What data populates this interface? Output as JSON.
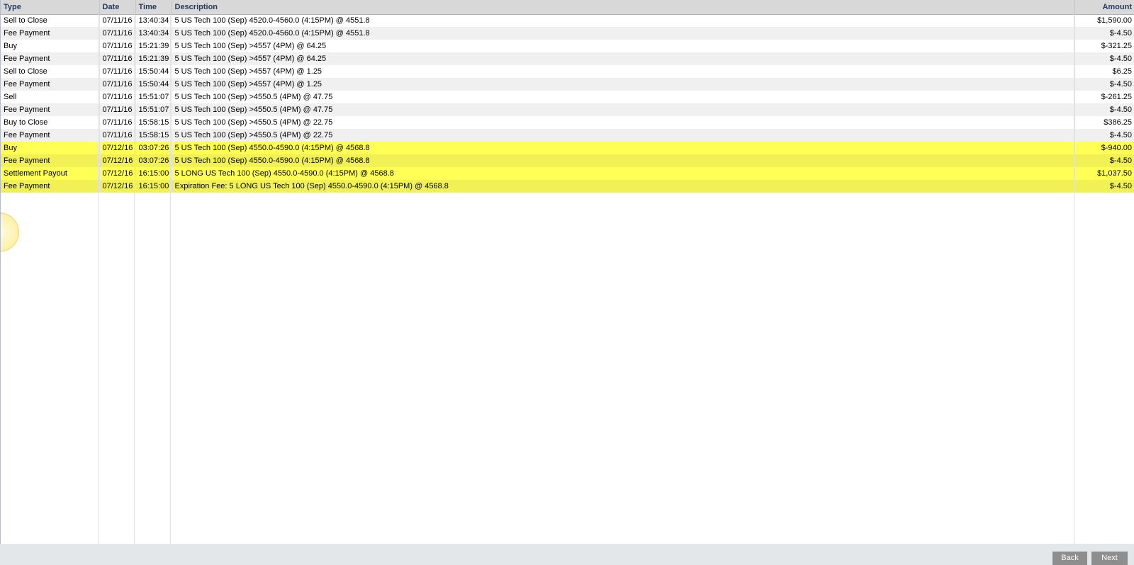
{
  "table": {
    "columns": {
      "type": "Type",
      "date": "Date",
      "time": "Time",
      "description": "Description",
      "amount": "Amount"
    },
    "rows": [
      {
        "type": "Sell to Close",
        "date": "07/11/16",
        "time": "13:40:34",
        "description": "5 US Tech 100 (Sep) 4520.0-4560.0 (4:15PM) @ 4551.8",
        "amount": "$1,590.00",
        "highlighted": false
      },
      {
        "type": "Fee Payment",
        "date": "07/11/16",
        "time": "13:40:34",
        "description": "5 US Tech 100 (Sep) 4520.0-4560.0 (4:15PM) @ 4551.8",
        "amount": "$-4.50",
        "highlighted": false
      },
      {
        "type": "Buy",
        "date": "07/11/16",
        "time": "15:21:39",
        "description": "5 US Tech 100 (Sep) >4557 (4PM) @ 64.25",
        "amount": "$-321.25",
        "highlighted": false
      },
      {
        "type": "Fee Payment",
        "date": "07/11/16",
        "time": "15:21:39",
        "description": "5 US Tech 100 (Sep) >4557 (4PM) @ 64.25",
        "amount": "$-4.50",
        "highlighted": false
      },
      {
        "type": "Sell to Close",
        "date": "07/11/16",
        "time": "15:50:44",
        "description": "5 US Tech 100 (Sep) >4557 (4PM) @ 1.25",
        "amount": "$6.25",
        "highlighted": false
      },
      {
        "type": "Fee Payment",
        "date": "07/11/16",
        "time": "15:50:44",
        "description": "5 US Tech 100 (Sep) >4557 (4PM) @ 1.25",
        "amount": "$-4.50",
        "highlighted": false
      },
      {
        "type": "Sell",
        "date": "07/11/16",
        "time": "15:51:07",
        "description": "5 US Tech 100 (Sep) >4550.5 (4PM) @ 47.75",
        "amount": "$-261.25",
        "highlighted": false
      },
      {
        "type": "Fee Payment",
        "date": "07/11/16",
        "time": "15:51:07",
        "description": "5 US Tech 100 (Sep) >4550.5 (4PM) @ 47.75",
        "amount": "$-4.50",
        "highlighted": false
      },
      {
        "type": "Buy to Close",
        "date": "07/11/16",
        "time": "15:58:15",
        "description": "5 US Tech 100 (Sep) >4550.5 (4PM) @ 22.75",
        "amount": "$386.25",
        "highlighted": false
      },
      {
        "type": "Fee Payment",
        "date": "07/11/16",
        "time": "15:58:15",
        "description": "5 US Tech 100 (Sep) >4550.5 (4PM) @ 22.75",
        "amount": "$-4.50",
        "highlighted": false
      },
      {
        "type": "Buy",
        "date": "07/12/16",
        "time": "03:07:26",
        "description": "5 US Tech 100 (Sep) 4550.0-4590.0 (4:15PM) @ 4568.8",
        "amount": "$-940.00",
        "highlighted": true
      },
      {
        "type": "Fee Payment",
        "date": "07/12/16",
        "time": "03:07:26",
        "description": "5 US Tech 100 (Sep) 4550.0-4590.0 (4:15PM) @ 4568.8",
        "amount": "$-4.50",
        "highlighted": true
      },
      {
        "type": "Settlement Payout",
        "date": "07/12/16",
        "time": "16:15:00",
        "description": "5 LONG US Tech 100 (Sep) 4550.0-4590.0 (4:15PM) @ 4568.8",
        "amount": "$1,037.50",
        "highlighted": true
      },
      {
        "type": "Fee Payment",
        "date": "07/12/16",
        "time": "16:15:00",
        "description": "Expiration Fee: 5 LONG US Tech 100 (Sep) 4550.0-4590.0 (4:15PM) @ 4568.8",
        "amount": "$-4.50",
        "highlighted": true
      }
    ]
  },
  "pagination": {
    "back_label": "Back",
    "next_label": "Next"
  }
}
